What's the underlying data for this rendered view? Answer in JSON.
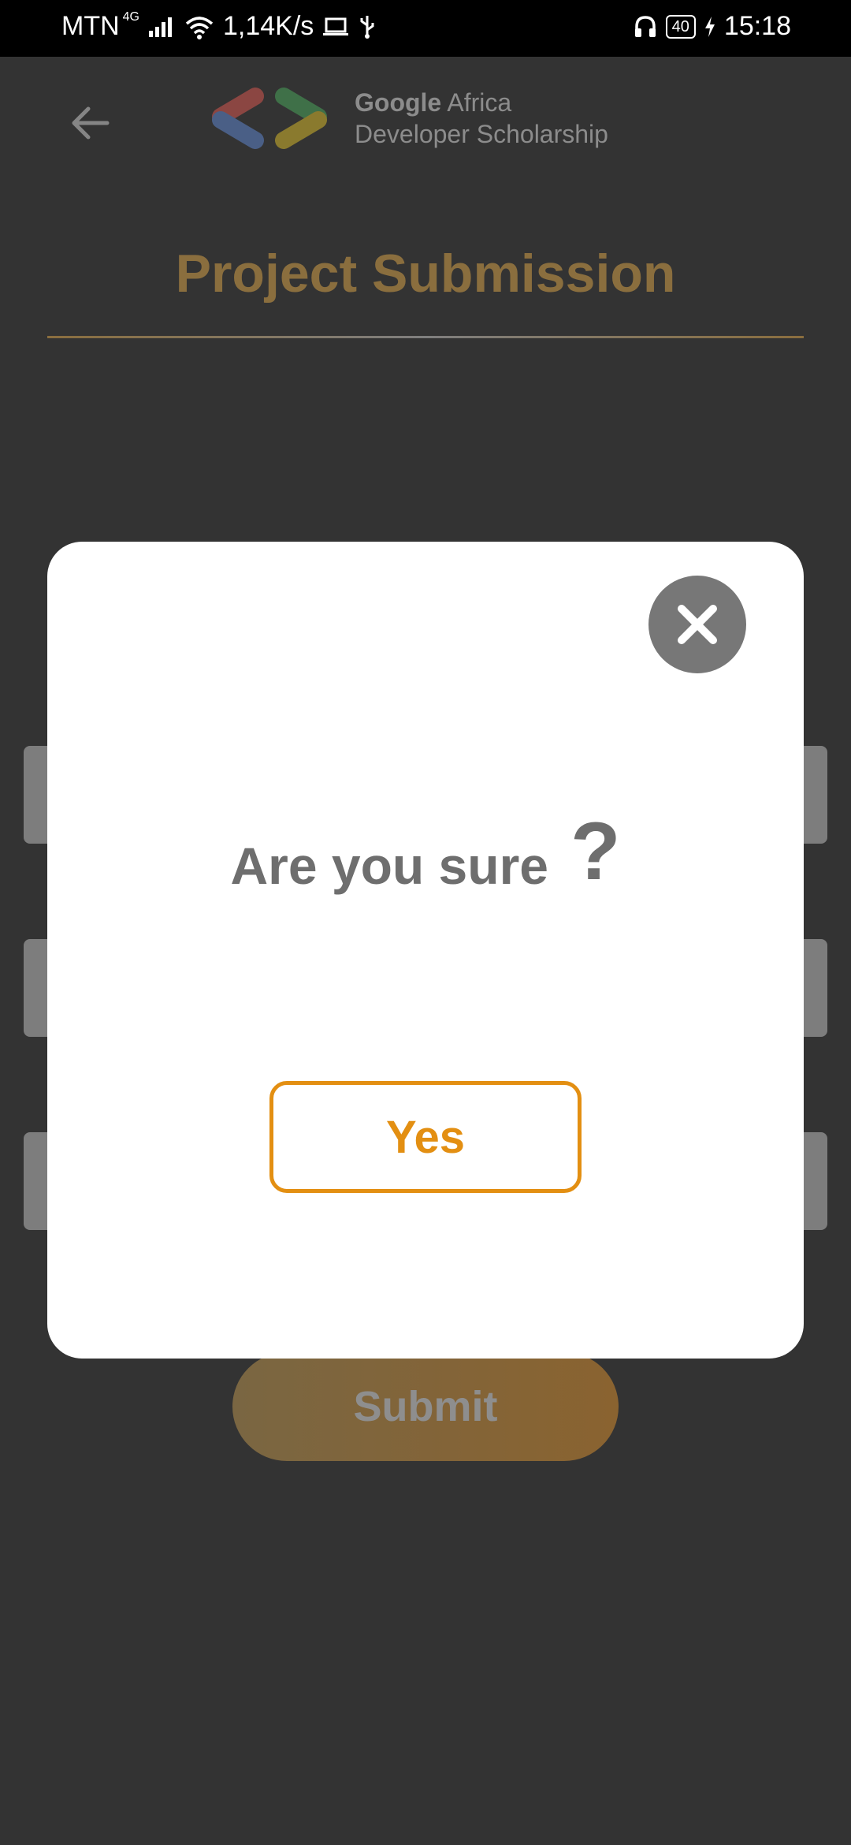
{
  "status_bar": {
    "carrier": "MTN",
    "network_type": "4G",
    "speed": "1,14K/s",
    "battery": "40",
    "time": "15:18"
  },
  "header": {
    "logo_text_brand": "Google",
    "logo_text_region": "Africa",
    "logo_text_line2": "Developer Scholarship"
  },
  "page": {
    "title": "Project Submission",
    "submit_label": "Submit"
  },
  "dialog": {
    "question": "Are you sure",
    "question_mark": "?",
    "yes_label": "Yes"
  },
  "colors": {
    "accent": "#e38f12",
    "title_gold": "#8a6e3e",
    "overlay_bg": "#333333"
  }
}
